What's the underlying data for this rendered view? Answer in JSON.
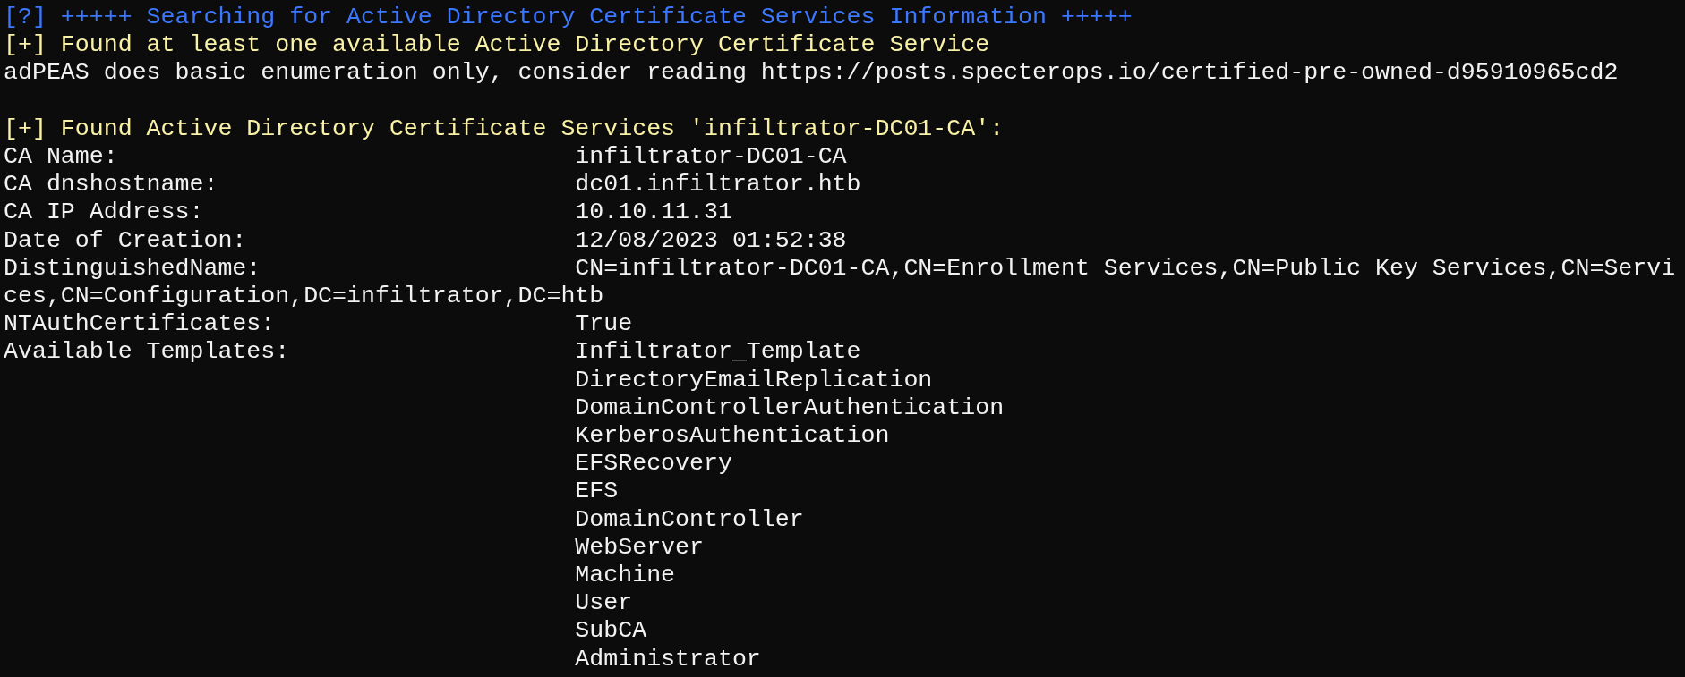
{
  "lines": [
    {
      "kind": "info",
      "text": "[?] +++++ Searching for Active Directory Certificate Services Information +++++"
    },
    {
      "kind": "found",
      "text": "[+] Found at least one available Active Directory Certificate Service"
    },
    {
      "kind": "plain",
      "text": "adPEAS does basic enumeration only, consider reading https://posts.specterops.io/certified-pre-owned-d95910965cd2"
    },
    {
      "kind": "blank"
    },
    {
      "kind": "found",
      "text": "[+] Found Active Directory Certificate Services 'infiltrator-DC01-CA':"
    },
    {
      "kind": "field",
      "label": "CA Name:",
      "value": "infiltrator-DC01-CA"
    },
    {
      "kind": "field",
      "label": "CA dnshostname:",
      "value": "dc01.infiltrator.htb"
    },
    {
      "kind": "field",
      "label": "CA IP Address:",
      "value": "10.10.11.31"
    },
    {
      "kind": "field",
      "label": "Date of Creation:",
      "value": "12/08/2023 01:52:38"
    },
    {
      "kind": "field",
      "label": "DistinguishedName:",
      "value": "CN=infiltrator-DC01-CA,CN=Enrollment Services,CN=Public Key Services,CN=Servi"
    },
    {
      "kind": "plain",
      "text": "ces,CN=Configuration,DC=infiltrator,DC=htb"
    },
    {
      "kind": "field",
      "label": "NTAuthCertificates:",
      "value": "True"
    },
    {
      "kind": "field",
      "label": "Available Templates:",
      "value": "Infiltrator_Template"
    },
    {
      "kind": "field",
      "value": "DirectoryEmailReplication"
    },
    {
      "kind": "field",
      "value": "DomainControllerAuthentication"
    },
    {
      "kind": "field",
      "value": "KerberosAuthentication"
    },
    {
      "kind": "field",
      "value": "EFSRecovery"
    },
    {
      "kind": "field",
      "value": "EFS"
    },
    {
      "kind": "field",
      "value": "DomainController"
    },
    {
      "kind": "field",
      "value": "WebServer"
    },
    {
      "kind": "field",
      "value": "Machine"
    },
    {
      "kind": "field",
      "value": "User"
    },
    {
      "kind": "field",
      "value": "SubCA"
    },
    {
      "kind": "field",
      "value": "Administrator"
    }
  ]
}
